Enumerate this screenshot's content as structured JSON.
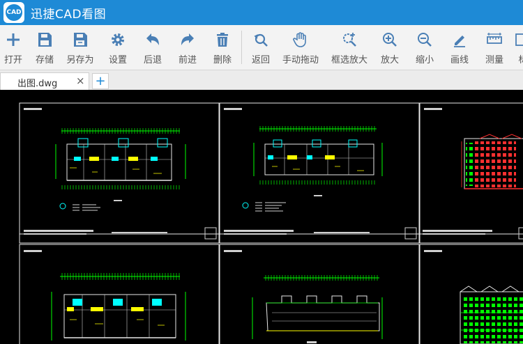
{
  "app": {
    "title": "迅捷CAD看图",
    "logo_text": "CAD"
  },
  "toolbar": {
    "open": "打开",
    "save": "存储",
    "save_as": "另存为",
    "settings": "设置",
    "back": "后退",
    "forward": "前进",
    "delete": "删除",
    "return": "返回",
    "pan": "手动拖动",
    "zoom_window": "框选放大",
    "zoom_in": "放大",
    "zoom_out": "缩小",
    "line": "画线",
    "measure": "测量",
    "more": "标"
  },
  "tabs": [
    {
      "label": "出图.dwg",
      "close": "×"
    }
  ],
  "add_tab": "+",
  "colors": {
    "accent": "#1e8ad6",
    "drawing_green": "#00ff00",
    "drawing_yellow": "#ffff00",
    "drawing_cyan": "#00ffff",
    "drawing_red": "#ff3030"
  }
}
